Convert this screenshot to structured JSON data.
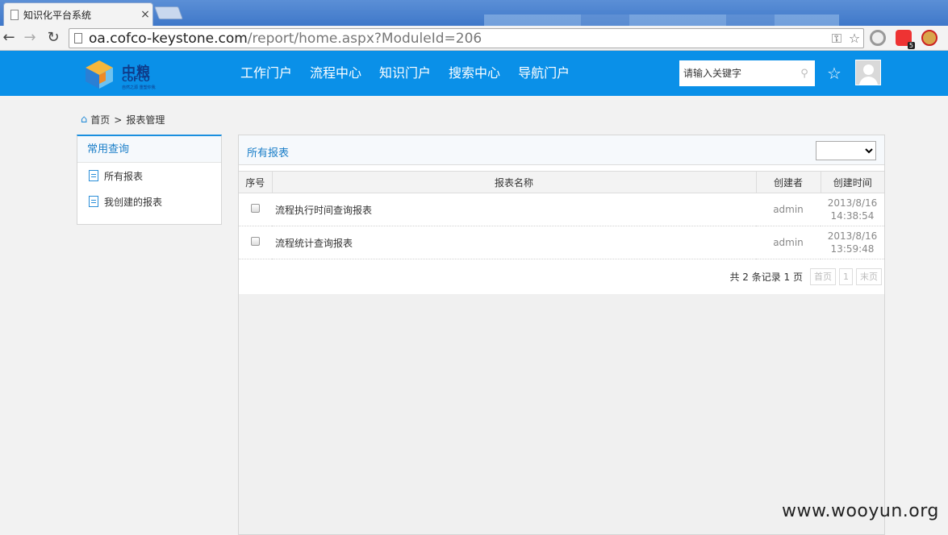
{
  "browser": {
    "tab_title": "知识化平台系统",
    "tab_close": "×",
    "url_host": "oa.cofco-keystone.com",
    "url_path": "/report/home.aspx?ModuleId=206",
    "ext_badge": "5"
  },
  "header": {
    "logo_cn": "中粮",
    "logo_en": "COFCO",
    "logo_slogan": "自然之源 重塑你我",
    "nav": [
      "工作门户",
      "流程中心",
      "知识门户",
      "搜索中心",
      "导航门户"
    ],
    "search_placeholder": "请输入关键字",
    "brand_color": "#0a90e8"
  },
  "breadcrumb": {
    "home": "首页",
    "separator": ">",
    "current": "报表管理"
  },
  "sidebar": {
    "title": "常用查询",
    "items": [
      "所有报表",
      "我创建的报表"
    ]
  },
  "main": {
    "title": "所有报表",
    "filter_value": "",
    "columns": [
      "序号",
      "报表名称",
      "创建者",
      "创建时间"
    ],
    "rows": [
      {
        "name": "流程执行时间查询报表",
        "creator": "admin",
        "date": "2013/8/16",
        "time": "14:38:54"
      },
      {
        "name": "流程统计查询报表",
        "creator": "admin",
        "date": "2013/8/16",
        "time": "13:59:48"
      }
    ],
    "pager": {
      "info": "共 2 条记录 1 页",
      "first": "首页",
      "page": "1",
      "last": "末页"
    }
  },
  "watermark": "www.wooyun.org"
}
